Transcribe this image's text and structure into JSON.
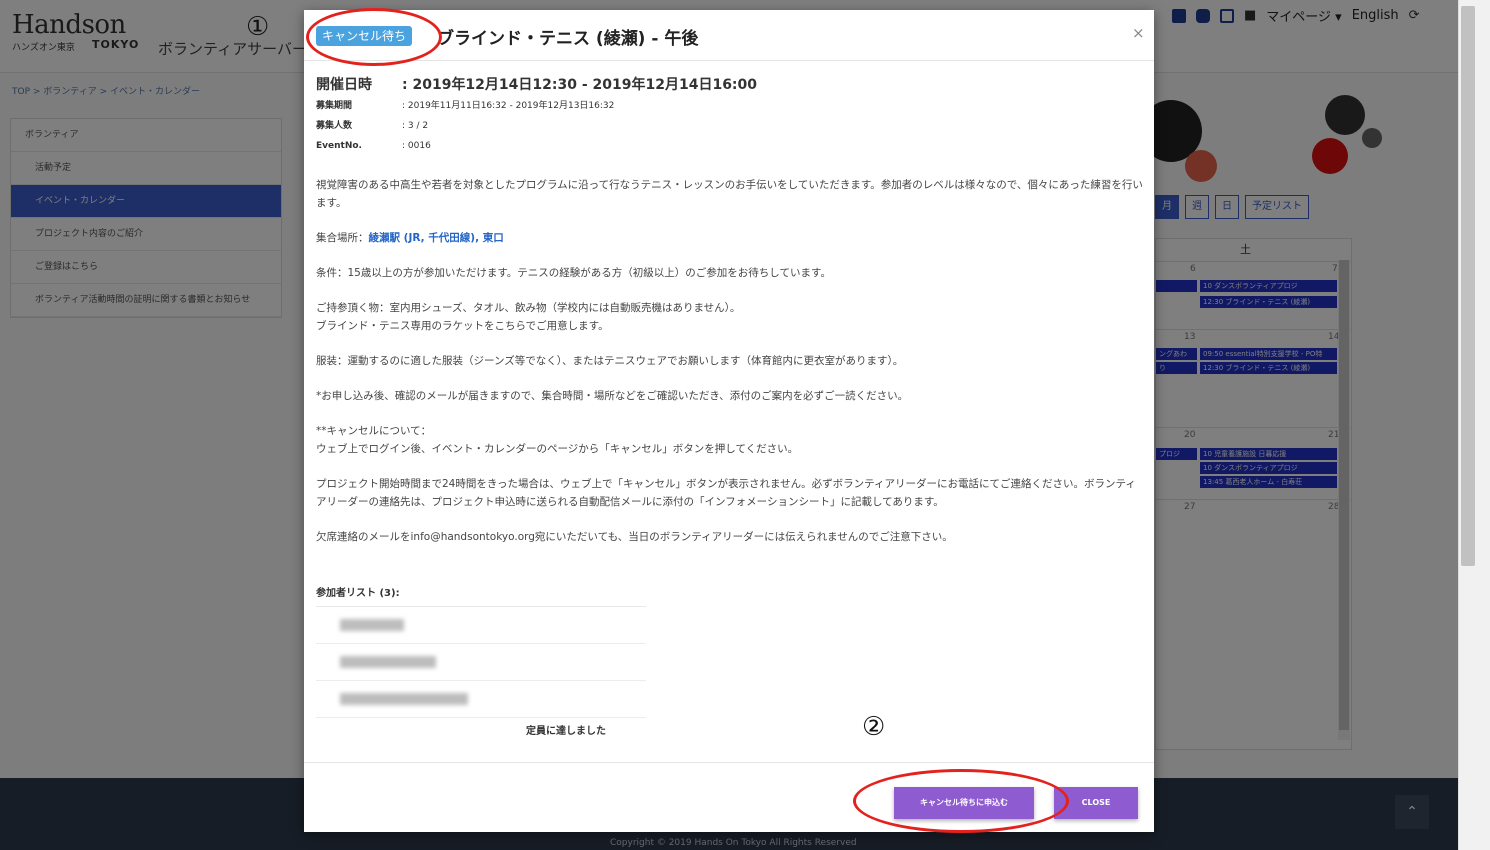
{
  "header": {
    "logo_main": "Handson",
    "logo_sub": "ハンズオン東京",
    "logo_tokyo": "TOKYO",
    "site_title": "ボランティアサーバー",
    "nav": {
      "mypage": "マイページ ▾",
      "language": "English"
    }
  },
  "breadcrumb": "TOP > ボランティア > イベント・カレンダー",
  "sidebar": {
    "items": [
      {
        "label": "ボランティア"
      },
      {
        "label": "活動予定"
      },
      {
        "label": "イベント・カレンダー"
      },
      {
        "label": "プロジェクト内容のご紹介"
      },
      {
        "label": "ご登録はこちら"
      },
      {
        "label": "ボランティア活動時間の証明に関する書類とお知らせ"
      }
    ]
  },
  "calendar": {
    "view_buttons": [
      "月",
      "週",
      "日",
      "予定リスト"
    ],
    "saturday_header": "土",
    "days": [
      "6",
      "7",
      "13",
      "14",
      "20",
      "21",
      "27",
      "28"
    ],
    "events": [
      "10 ダンスボランティアプロジ",
      "12:30 ブラインド・テニス (綾瀬)",
      "ングあわ",
      "り",
      "09:50 essential特別支援学校 - PO特",
      "12:30 ブラインド・テニス (綾瀬)",
      "プロジ",
      "10 児童養護施設 日暮応援",
      "10 ダンスボランティアプロジ",
      "13:45 葛西老人ホーム - 白寿荘"
    ]
  },
  "modal": {
    "badge": "キャンセル待ち",
    "title": "ブラインド・テニス (綾瀬) - 午後",
    "close_x": "×",
    "info": {
      "date_label": "開催日時",
      "date_value": ": 2019年12月14日12:30 - 2019年12月14日16:00",
      "period_label": "募集期間",
      "period_value": ": 2019年11月11日16:32 - 2019年12月13日16:32",
      "count_label": "募集人数",
      "count_value": ": 3 / 2",
      "event_label": "EventNo.",
      "event_value": ": 0016"
    },
    "desc": {
      "p1": "視覚障害のある中高生や若者を対象としたプログラムに沿って行なうテニス・レッスンのお手伝いをしていただきます。参加者のレベルは様々なので、個々にあった練習を行います。",
      "meet_label": "集合場所：",
      "meet_link": "綾瀬駅 (JR, 千代田線), 東口",
      "p3": "条件：15歳以上の方が参加いただけます。テニスの経験がある方（初級以上）のご参加をお待ちしています。",
      "p4a": "ご持参頂く物：室内用シューズ、タオル、飲み物（学校内には自動販売機はありません）。",
      "p4b": "ブラインド・テニス専用のラケットをこちらでご用意します。",
      "p5": "服装：運動するのに適した服装（ジーンズ等でなく）、またはテニスウェアでお願いします（体育館内に更衣室があります）。",
      "p6": "*お申し込み後、確認のメールが届きますので、集合時間・場所などをご確認いただき、添付のご案内を必ずご一読ください。",
      "p7a": "**キャンセルについて：",
      "p7b": "ウェブ上でログイン後、イベント・カレンダーのページから「キャンセル」ボタンを押してください。",
      "p8": "プロジェクト開始時間まで24時間をきった場合は、ウェブ上で「キャンセル」ボタンが表示されません。必ずボランティアリーダーにお電話にてご連絡ください。ボランティアリーダーの連絡先は、プロジェクト申込時に送られる自動配信メールに添付の「インフォメーションシート」に記載してあります。",
      "p9": "欠席連絡のメールをinfo@handsontokyo.org宛にいただいても、当日のボランティアリーダーには伝えられませんのでご注意下さい。"
    },
    "participants_title": "参加者リスト (3):",
    "full_text": "定員に達しました",
    "apply_button": "キャンセル待ちに申込む",
    "close_button": "CLOSE"
  },
  "footer": {
    "copyright": "Copyright © 2019 Hands On Tokyo All Rights Reserved"
  },
  "annotations": {
    "one": "①",
    "two": "②"
  },
  "colors": {
    "accent": "#8e5bd1",
    "badge": "#4aa3df",
    "annotation": "#e3221e",
    "nav_active": "#3a5fcd",
    "event": "#2432c8"
  }
}
